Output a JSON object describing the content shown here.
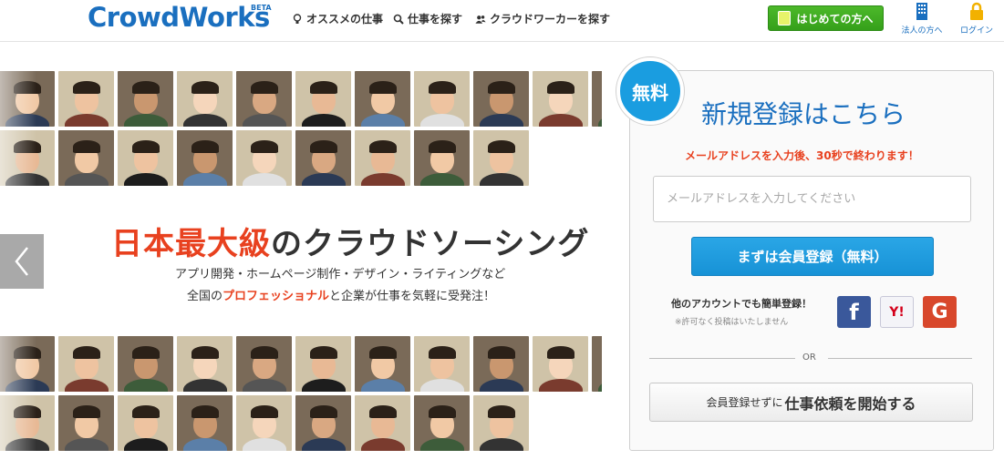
{
  "header": {
    "logo": "CrowdWorks",
    "logo_badge": "BETA",
    "nav": [
      {
        "label": "オススメの仕事",
        "icon": "lightbulb-icon"
      },
      {
        "label": "仕事を探す",
        "icon": "search-icon"
      },
      {
        "label": "クラウドワーカーを探す",
        "icon": "users-icon"
      }
    ],
    "first_button": "はじめての方へ",
    "corporate_link": "法人の方へ",
    "login_link": "ログイン",
    "colors": {
      "brand": "#1a6fbf",
      "green": "#3aa41e",
      "accent_red": "#e8411f"
    }
  },
  "hero": {
    "headline_red": "日本最大級",
    "headline_rest": "のクラウドソーシング",
    "sub1": "アプリ開発・ホームページ制作・デザイン・ライティングなど",
    "sub2_a": "全国の",
    "sub2_red": "プロフェッショナル",
    "sub2_b": "と企業が仕事を気軽に受発注！",
    "prev_icon": "chevron-left-icon"
  },
  "signup": {
    "badge": "無料",
    "title": "新規登録はこちら",
    "note": "メールアドレスを入力後、30秒で終わります！",
    "email_placeholder": "メールアドレスを入力してください",
    "register_button": "まずは会員登録（無料）",
    "social_label": "他のアカウントでも簡単登録！",
    "social_note": "※許可なく投稿はいたしません",
    "sns": {
      "facebook": "f",
      "yahoo": "Y!",
      "google": "G"
    },
    "or_text": "OR",
    "job_button_small": "会員登録せずに",
    "job_button_big": "仕事依頼を開始する"
  }
}
